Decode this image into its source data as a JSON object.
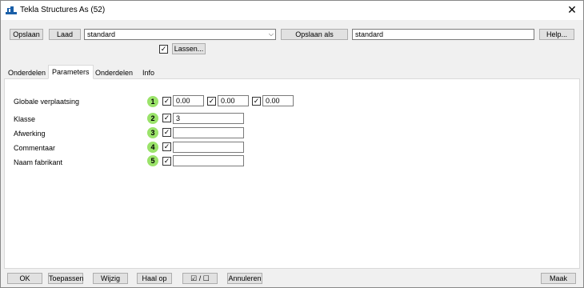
{
  "window": {
    "title": "Tekla Structures  As (52)",
    "close_glyph": "✕"
  },
  "toolbar": {
    "save_label": "Opslaan",
    "load_label": "Laad",
    "load_value": "standard",
    "save_as_label": "Opslaan als",
    "save_as_value": "standard",
    "help_label": "Help...",
    "welds_checked": true,
    "welds_label": "Lassen..."
  },
  "tabs": [
    {
      "label": "Onderdelen",
      "active": false
    },
    {
      "label": "Parameters",
      "active": true
    },
    {
      "label": "Onderdelen",
      "active": false
    },
    {
      "label": "Info",
      "active": false
    }
  ],
  "parameters": {
    "rows": [
      {
        "label": "Globale verplaatsing",
        "badge": "1",
        "values": [
          "0.00",
          "0.00",
          "0.00"
        ]
      },
      {
        "label": "Klasse",
        "badge": "2",
        "value": "3"
      },
      {
        "label": "Afwerking",
        "badge": "3",
        "value": ""
      },
      {
        "label": "Commentaar",
        "badge": "4",
        "value": ""
      },
      {
        "label": "Naam fabrikant",
        "badge": "5",
        "value": ""
      }
    ]
  },
  "footer": {
    "ok_label": "OK",
    "apply_label": "Toepassen",
    "modify_label": "Wijzig",
    "get_label": "Haal op",
    "toggle_label": "☑ / ☐",
    "cancel_label": "Annuleren",
    "create_label": "Maak"
  },
  "colors": {
    "badge": "#9be36a",
    "window_bg": "#f0f0f0"
  }
}
